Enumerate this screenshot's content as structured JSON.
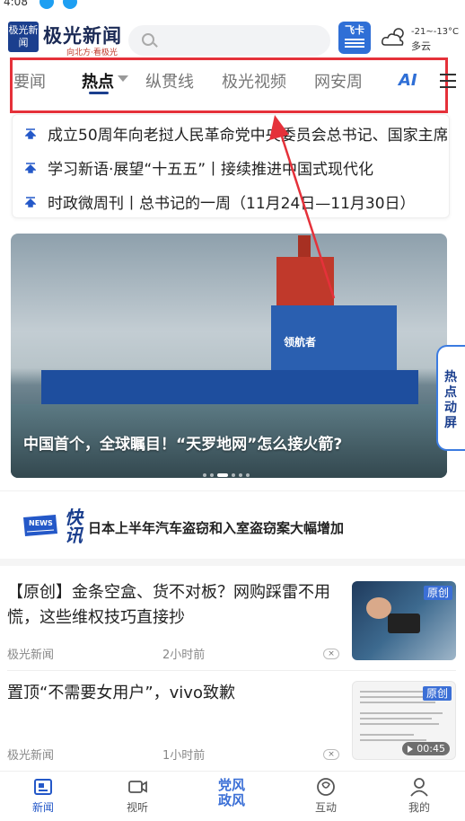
{
  "status_bar": {
    "time": "4:08"
  },
  "header": {
    "logo_box_text": "极光新闻",
    "logo_text": "极光新闻",
    "logo_slogan": "向北方·看极光",
    "search_placeholder": "",
    "fk_icon_label": "飞卡",
    "weather": {
      "temp": "-21~-13°C",
      "condition": "多云"
    }
  },
  "tabs": [
    {
      "label": "要闻",
      "active": false
    },
    {
      "label": "热点",
      "active": true
    },
    {
      "label": "纵贯线",
      "active": false
    },
    {
      "label": "极光视频",
      "active": false
    },
    {
      "label": "网安周",
      "active": false
    }
  ],
  "ai_label": "AI",
  "headlines": [
    "成立50周年向老挝人民革命党中央委员会总书记、国家主席",
    "学习新语·展望“十五五”丨接续推进中国式现代化",
    "时政微周刊丨总书记的一周（11月24日—11月30日）"
  ],
  "carousel": {
    "caption": "中国首个，全球瞩目！“天罗地网”怎么接火箭?",
    "ship_name": "领航者",
    "slide_count": 6,
    "active_slide": 2
  },
  "hot_tab_label": "热点动屏",
  "flash_news": {
    "icon_label": "NEWS",
    "kuai_label": "快讯",
    "text": "日本上半年汽车盗窃和入室盗窃案大幅增加"
  },
  "articles": [
    {
      "title": "【原创】金条空盒、货不对板？网购踩雷不用慌，这些维权技巧直接抄",
      "source": "极光新闻",
      "time": "2小时前",
      "badge": "原创"
    },
    {
      "title": "置顶“不需要女用户”，vivo致歉",
      "source": "极光新闻",
      "time": "1小时前",
      "badge": "原创",
      "duration": "00:45"
    }
  ],
  "bottom_nav": [
    {
      "label": "新闻",
      "icon": "news-icon",
      "active": true
    },
    {
      "label": "视听",
      "icon": "video-icon",
      "active": false
    },
    {
      "label": "党风政风",
      "icon": "party-style-icon",
      "active": false
    },
    {
      "label": "互动",
      "icon": "interaction-icon",
      "active": false
    },
    {
      "label": "我的",
      "icon": "profile-icon",
      "active": false
    }
  ],
  "colors": {
    "brand_blue": "#1b3f8e",
    "accent_blue": "#2458c8",
    "highlight_red": "#e5313a"
  }
}
